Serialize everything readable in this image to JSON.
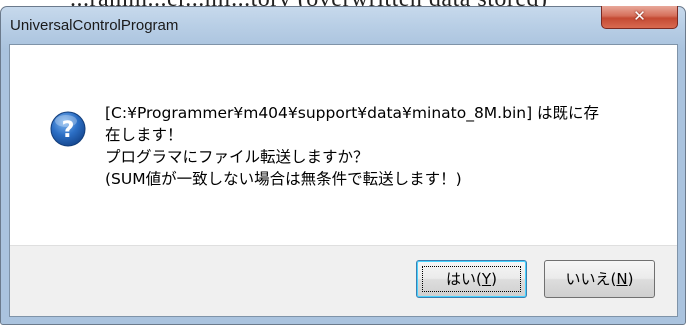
{
  "background_partial_text": "...ramm...er...mi...tory (overwritten data stored)",
  "window": {
    "title": "UniversalControlProgram",
    "close_glyph": "✕"
  },
  "dialog": {
    "icon": "question-icon",
    "message_lines": [
      "[C:¥Programmer¥m404¥support¥data¥minato_8M.bin] は既に存",
      "在します！",
      " プログラマにファイル転送しますか？",
      " (SUM値が一致しない場合は無条件で転送します！)"
    ],
    "buttons": {
      "yes_label": "はい(",
      "yes_mnemonic": "Y",
      "yes_suffix": ")",
      "no_label": "いいえ(",
      "no_mnemonic": "N",
      "no_suffix": ")"
    }
  },
  "colors": {
    "icon_blue": "#1f63b8",
    "close_red": "#c44a33",
    "frame": "#b9cfe6"
  }
}
